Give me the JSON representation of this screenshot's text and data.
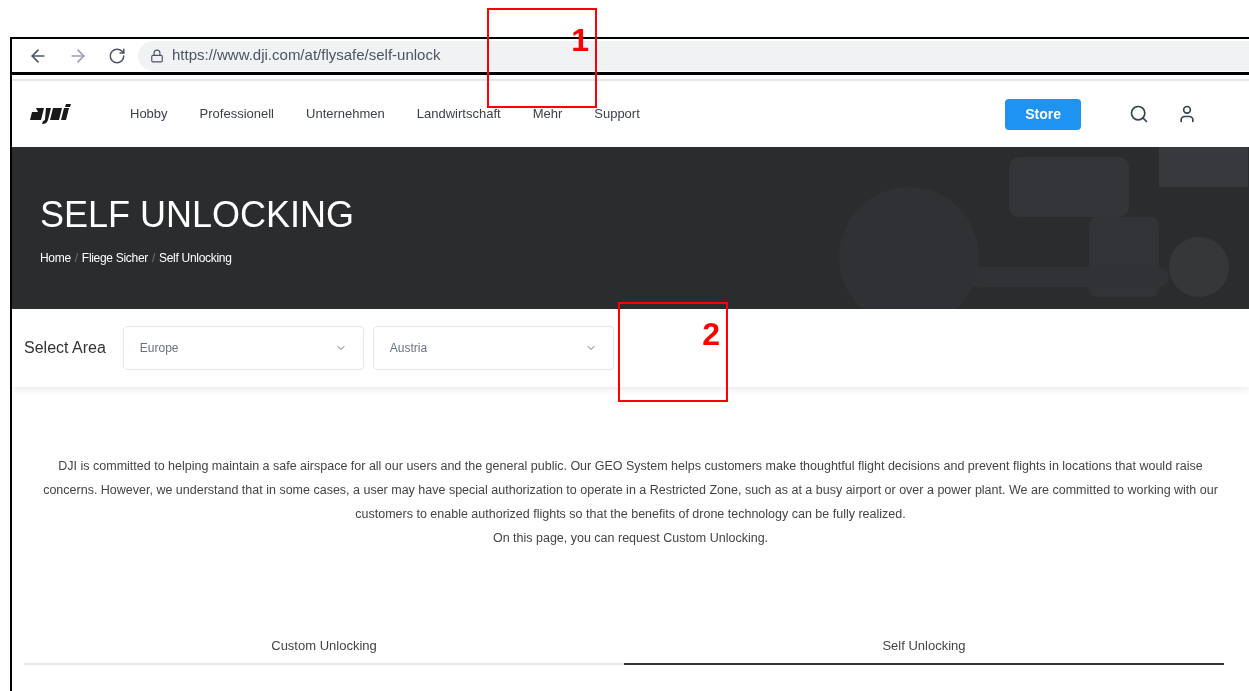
{
  "browser": {
    "url": "https://www.dji.com/at/flysafe/self-unlock"
  },
  "nav": {
    "items": [
      "Hobby",
      "Professionell",
      "Unternehmen",
      "Landwirtschaft",
      "Mehr",
      "Support"
    ],
    "store_button": "Store"
  },
  "hero": {
    "title": "SELF UNLOCKING",
    "breadcrumb": [
      "Home",
      "Fliege Sicher",
      "Self Unlocking"
    ],
    "breadcrumb_separator": "/"
  },
  "select_area": {
    "label": "Select Area",
    "selects": [
      {
        "value": "Europe"
      },
      {
        "value": "Austria"
      }
    ]
  },
  "intro": {
    "paragraph": "DJI is committed to helping maintain a safe airspace for all our users and the general public. Our GEO System helps customers make thoughtful flight decisions and prevent flights in locations that would raise concerns. However, we understand that in some cases, a user may have special authorization to operate in a Restricted Zone, such as at a busy airport or over a power plant. We are committed to working with our customers to enable authorized flights so that the benefits of drone technology can be fully realized.",
    "note": "On this page, you can request Custom Unlocking."
  },
  "tabs": [
    {
      "label": "Custom Unlocking",
      "selected": false
    },
    {
      "label": "Self Unlocking",
      "selected": true
    }
  ],
  "annotations": [
    {
      "label": "1"
    },
    {
      "label": "2"
    }
  ]
}
